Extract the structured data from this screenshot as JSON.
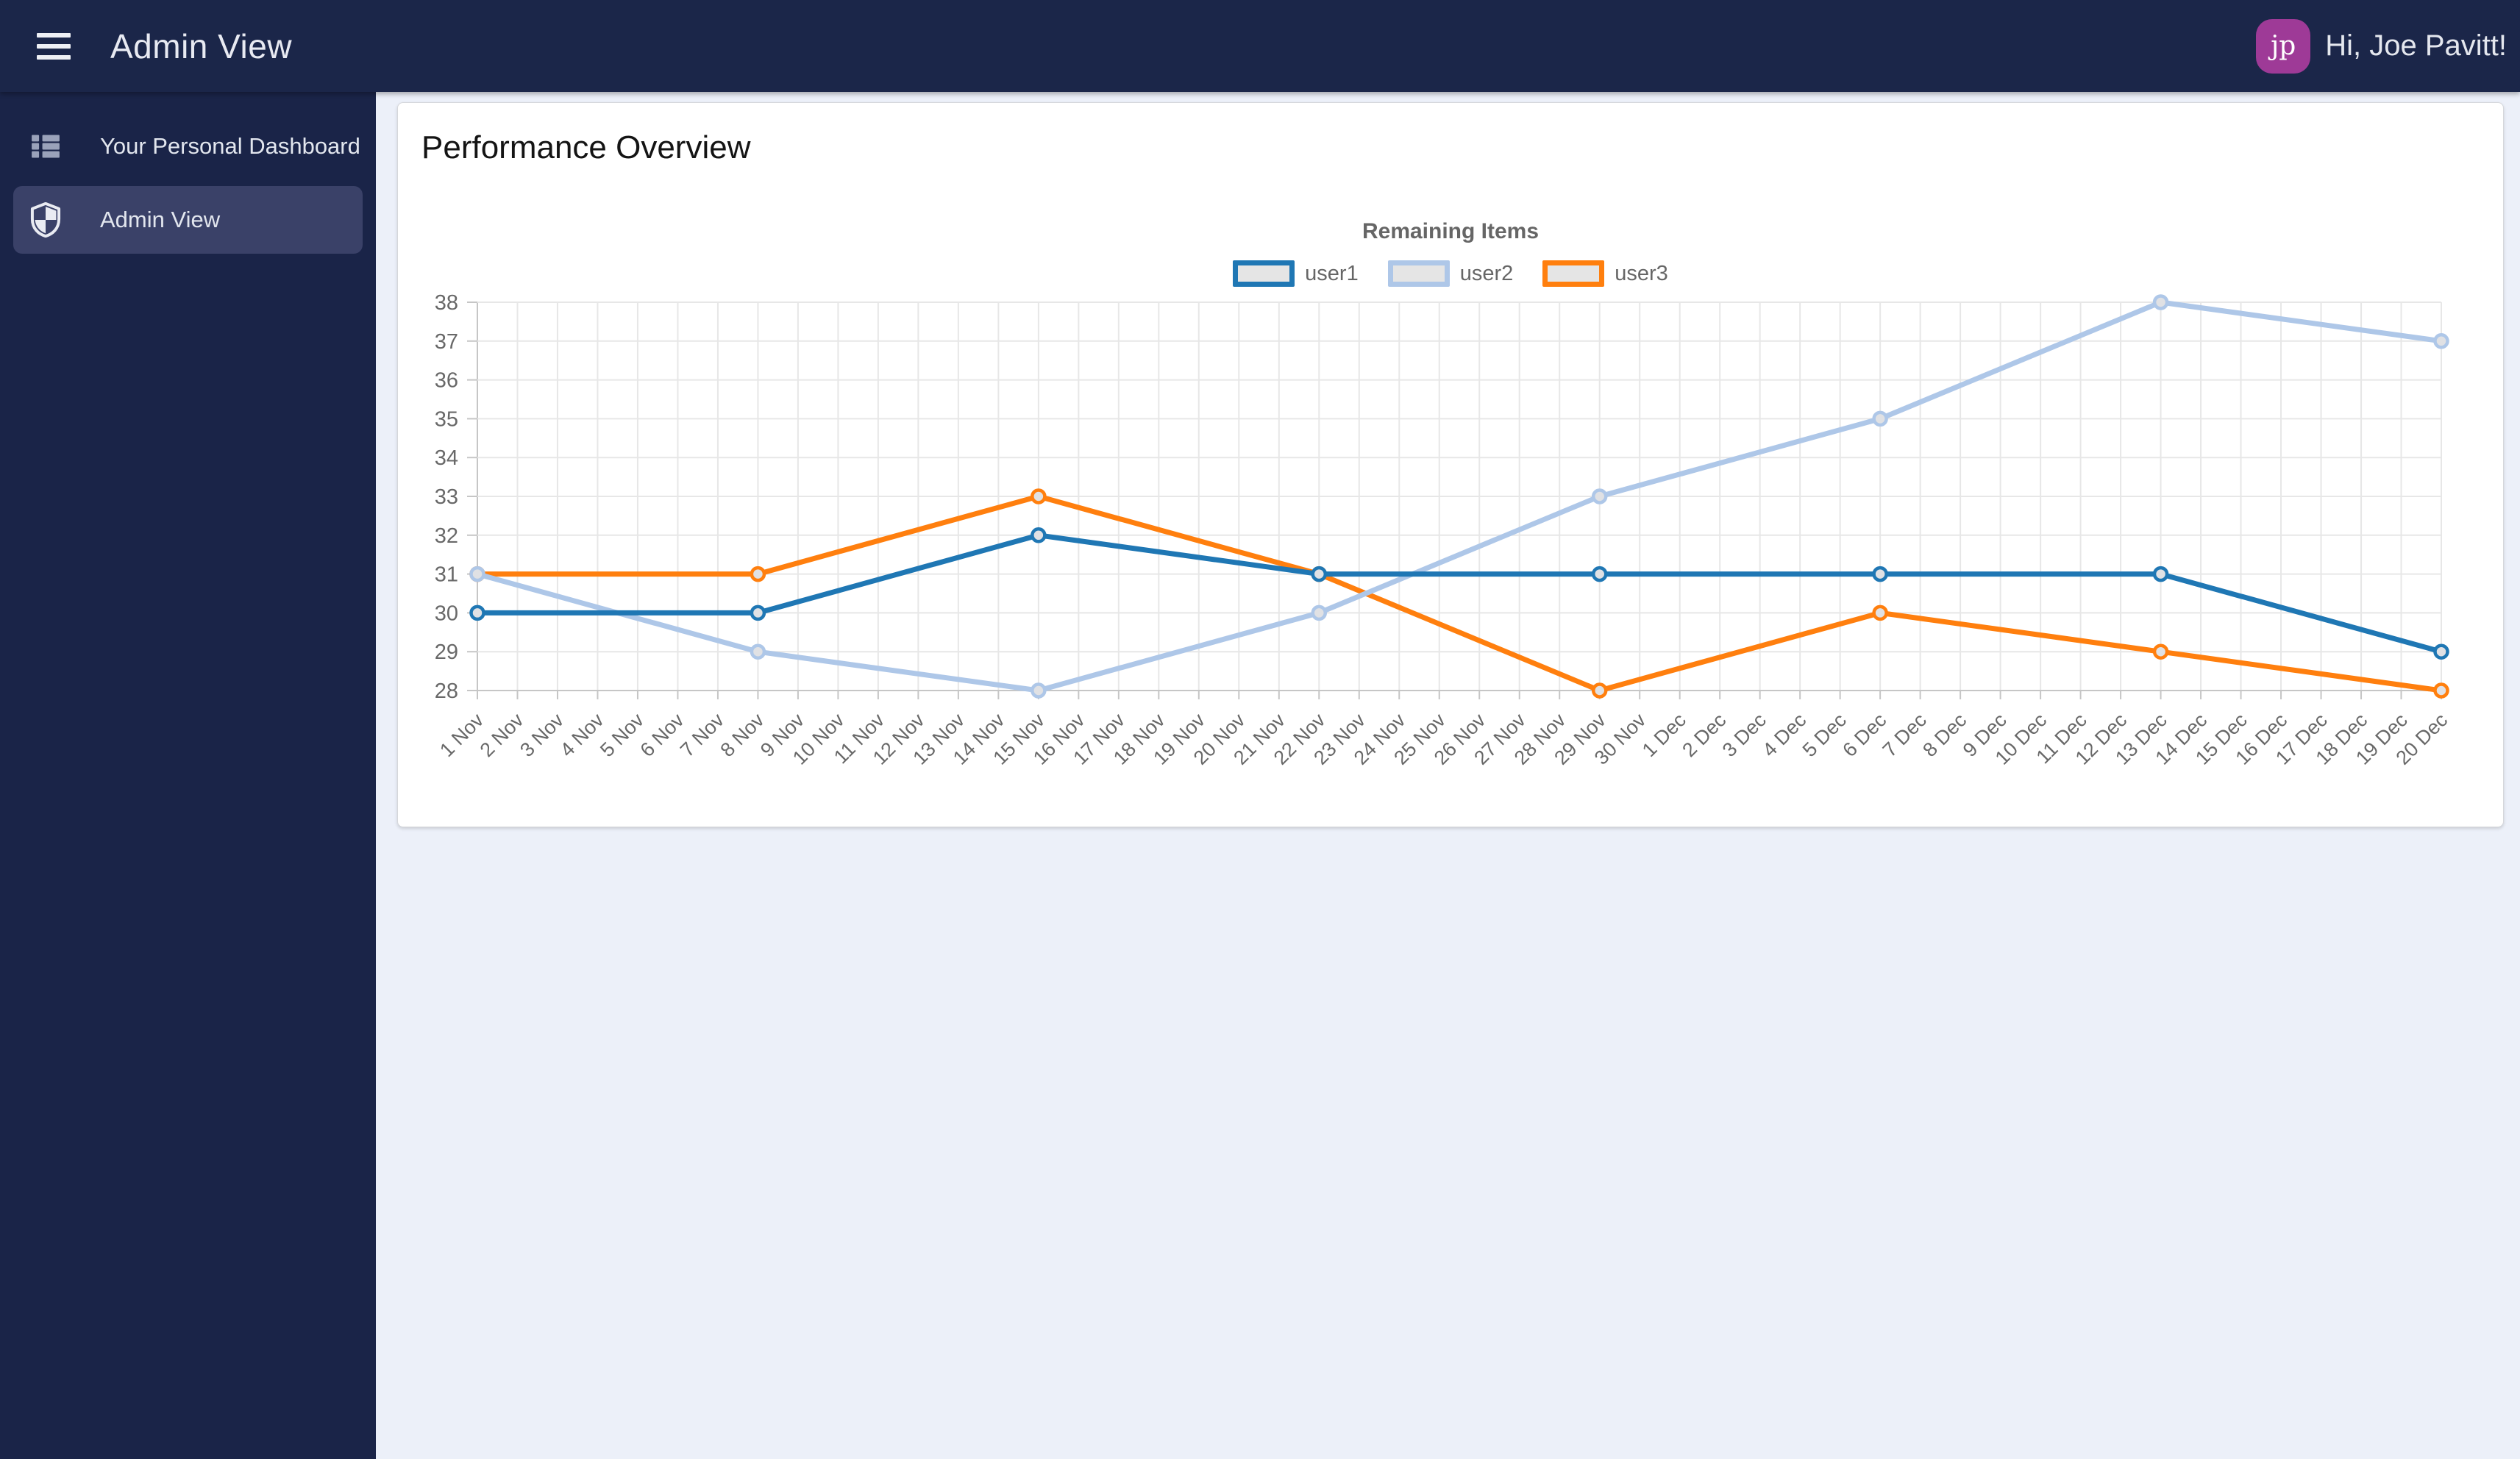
{
  "topbar": {
    "title": "Admin View",
    "greeting": "Hi, Joe Pavitt!",
    "avatar_initials": "jp",
    "bar_color": "#1b2649",
    "avatar_color": "#9e3a97"
  },
  "sidebar": {
    "items": [
      {
        "label": "Your Personal Dashboard",
        "icon": "dashboard-list-icon",
        "active": false
      },
      {
        "label": "Admin View",
        "icon": "shield-icon",
        "active": true
      }
    ]
  },
  "main": {
    "card_title": "Performance Overview"
  },
  "chart_data": {
    "type": "line",
    "title": "Remaining Items",
    "xlabel": "",
    "ylabel": "",
    "ylim": [
      28,
      38
    ],
    "y_ticks": [
      28,
      29,
      30,
      31,
      32,
      33,
      34,
      35,
      36,
      37,
      38
    ],
    "grid": true,
    "legend_position": "top",
    "x_labels": [
      "1 Nov",
      "2 Nov",
      "3 Nov",
      "4 Nov",
      "5 Nov",
      "6 Nov",
      "7 Nov",
      "8 Nov",
      "9 Nov",
      "10 Nov",
      "11 Nov",
      "12 Nov",
      "13 Nov",
      "14 Nov",
      "15 Nov",
      "16 Nov",
      "17 Nov",
      "18 Nov",
      "19 Nov",
      "20 Nov",
      "21 Nov",
      "22 Nov",
      "23 Nov",
      "24 Nov",
      "25 Nov",
      "26 Nov",
      "27 Nov",
      "28 Nov",
      "29 Nov",
      "30 Nov",
      "1 Dec",
      "2 Dec",
      "3 Dec",
      "4 Dec",
      "5 Dec",
      "6 Dec",
      "7 Dec",
      "8 Dec",
      "9 Dec",
      "10 Dec",
      "11 Dec",
      "12 Dec",
      "13 Dec",
      "14 Dec",
      "15 Dec",
      "16 Dec",
      "17 Dec",
      "18 Dec",
      "19 Dec",
      "20 Dec"
    ],
    "point_indices": [
      0,
      7,
      14,
      21,
      28,
      35,
      42,
      49
    ],
    "point_dates": [
      "1 Nov",
      "8 Nov",
      "15 Nov",
      "22 Nov",
      "29 Nov",
      "6 Dec",
      "13 Dec",
      "20 Dec"
    ],
    "series": [
      {
        "name": "user1",
        "color": "#1f77b4",
        "values": [
          30,
          30,
          32,
          31,
          31,
          31,
          31,
          29
        ]
      },
      {
        "name": "user2",
        "color": "#aec7e8",
        "values": [
          31,
          29,
          28,
          30,
          33,
          35,
          38,
          37
        ]
      },
      {
        "name": "user3",
        "color": "#ff7f0e",
        "values": [
          31,
          31,
          33,
          31,
          28,
          30,
          29,
          28
        ]
      }
    ],
    "style": {
      "grid_color": "#e7e7e7",
      "edge_color": "#c6c6c6",
      "tick_text_color": "#686868",
      "point_fill": "#e0e1e4"
    }
  }
}
